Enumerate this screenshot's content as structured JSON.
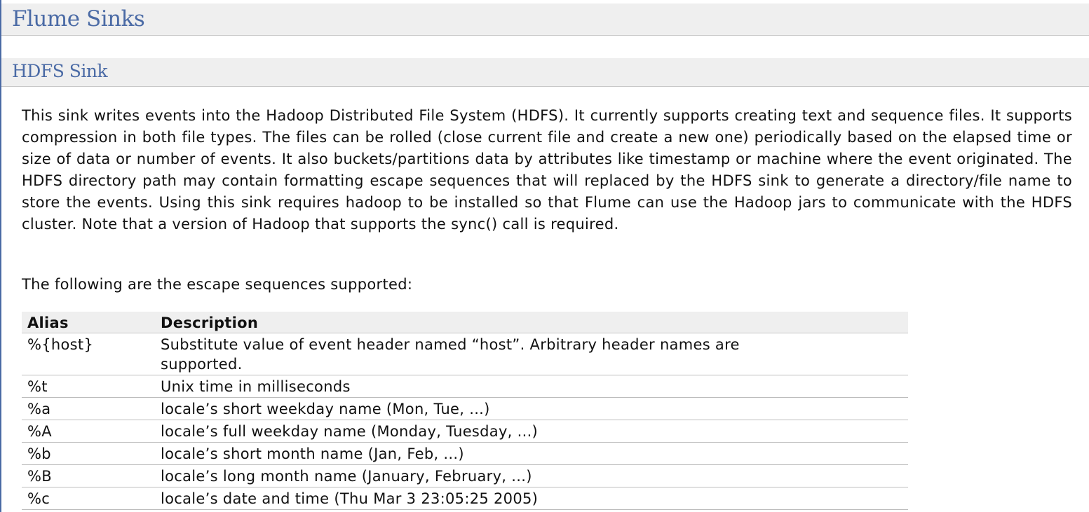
{
  "heading": "Flume Sinks",
  "subheading": "HDFS Sink",
  "intro": "This sink writes events into the Hadoop Distributed File System (HDFS). It currently supports creating text and sequence files. It supports compression in both file types. The files can be rolled (close current file and create a new one) periodically based on the elapsed time or size of data or number of events. It also buckets/partitions data by attributes like timestamp or machine where the event originated. The HDFS directory path may contain formatting escape sequences that will replaced by the HDFS sink to generate a directory/file name to store the events. Using this sink requires hadoop to be installed so that Flume can use the Hadoop jars to communicate with the HDFS cluster. Note that a version of Hadoop that supports the sync() call is required.",
  "escape_intro": "The following are the escape sequences supported:",
  "table": {
    "headers": [
      "Alias",
      "Description"
    ],
    "rows": [
      {
        "alias": "%{host}",
        "description": "Substitute value of event header named “host”. Arbitrary header names are supported."
      },
      {
        "alias": "%t",
        "description": "Unix time in milliseconds"
      },
      {
        "alias": "%a",
        "description": "locale’s short weekday name (Mon, Tue, ...)"
      },
      {
        "alias": "%A",
        "description": "locale’s full weekday name (Monday, Tuesday, ...)"
      },
      {
        "alias": "%b",
        "description": "locale’s short month name (Jan, Feb, ...)"
      },
      {
        "alias": "%B",
        "description": "locale’s long month name (January, February, ...)"
      },
      {
        "alias": "%c",
        "description": "locale’s date and time (Thu Mar 3 23:05:25 2005)"
      }
    ]
  },
  "colors": {
    "heading_text": "#4a6aa5",
    "heading_bg": "#efefef",
    "body_text": "#111111"
  }
}
